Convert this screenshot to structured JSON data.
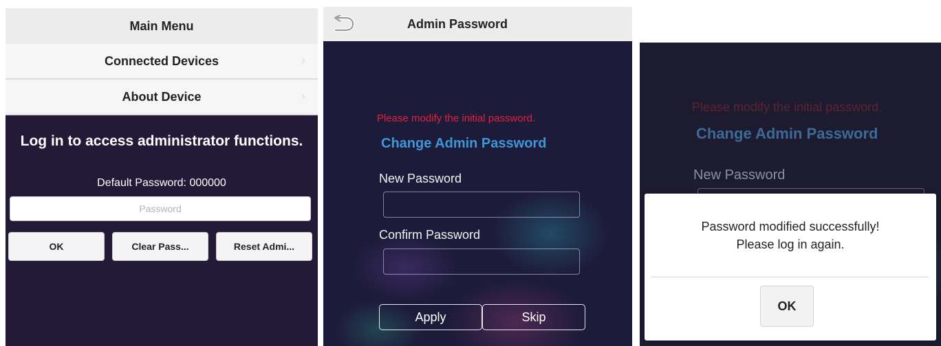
{
  "panel1": {
    "header_title": "Main Menu",
    "menu_items": [
      {
        "label": "Connected Devices"
      },
      {
        "label": "About Device"
      }
    ],
    "login_title": "Log in to access administrator functions.",
    "default_password_text": "Default Password: 000000",
    "password_placeholder": "Password",
    "buttons": {
      "ok": "OK",
      "clear": "Clear Pass...",
      "reset": "Reset Admi..."
    }
  },
  "panel2": {
    "header_title": "Admin Password",
    "warning": "Please modify the initial password.",
    "section_title": "Change Admin Password",
    "new_password_label": "New Password",
    "confirm_password_label": "Confirm Password",
    "apply_label": "Apply",
    "skip_label": "Skip"
  },
  "panel3": {
    "warning": "Please modify the initial password.",
    "section_title": "Change Admin Password",
    "new_password_label": "New Password",
    "dialog": {
      "message_line1": "Password modified successfully!",
      "message_line2": "Please log in again.",
      "ok_label": "OK"
    }
  },
  "colors": {
    "dark_background": "#231a37",
    "warning_red": "#e8203a",
    "title_blue": "#3f97d8",
    "header_gray": "#ececec"
  }
}
